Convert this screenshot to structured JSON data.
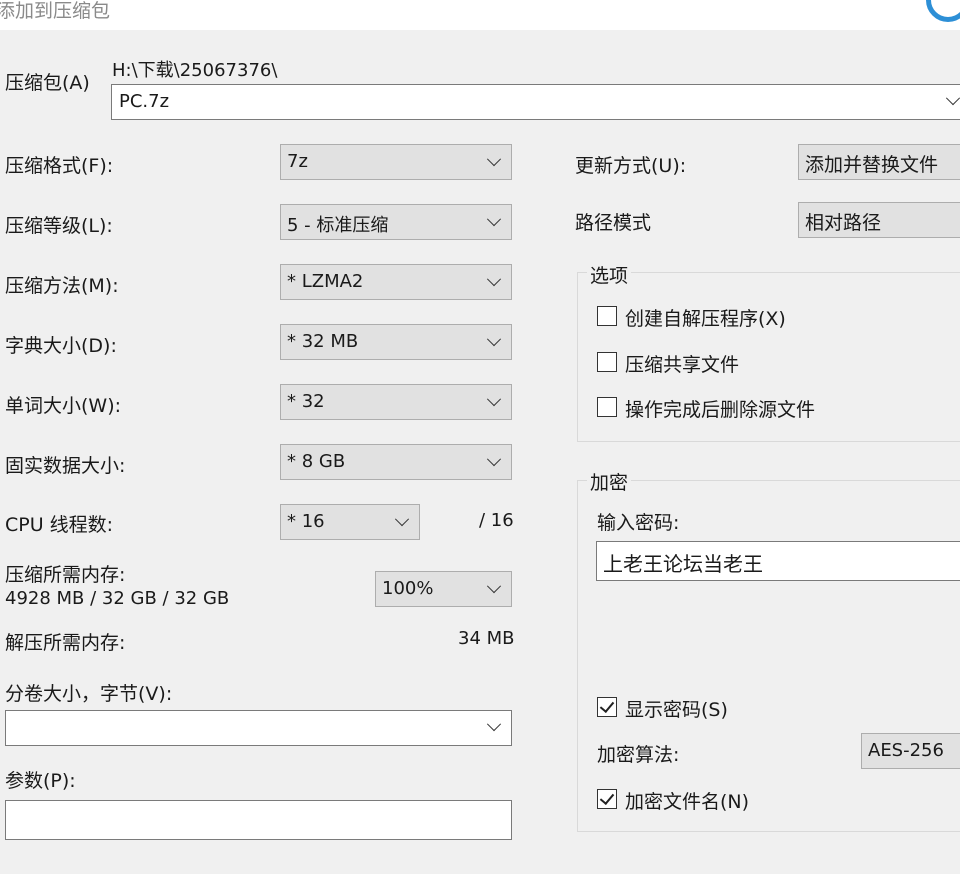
{
  "window": {
    "title": "添加到压缩包"
  },
  "archive": {
    "label": "压缩包(A)",
    "path": "H:\\下载\\25067376\\",
    "name": "PC.7z"
  },
  "left_fields": [
    {
      "label": "压缩格式(F):",
      "value": "7z"
    },
    {
      "label": "压缩等级(L):",
      "value": "5 - 标准压缩"
    },
    {
      "label": "压缩方法(M):",
      "value": "*  LZMA2"
    },
    {
      "label": "字典大小(D):",
      "value": "*  32 MB"
    },
    {
      "label": "单词大小(W):",
      "value": "*  32"
    },
    {
      "label": "固实数据大小:",
      "value": "*  8 GB"
    }
  ],
  "cpu": {
    "label": "CPU 线程数:",
    "value": "*  16",
    "max": "/ 16"
  },
  "memory": {
    "compress_label": "压缩所需内存:",
    "compress_value": "4928 MB / 32 GB / 32 GB",
    "percent": "100%",
    "decompress_label": "解压所需内存:",
    "decompress_value": "34 MB"
  },
  "split": {
    "label": "分卷大小，字节(V):",
    "value": ""
  },
  "params": {
    "label": "参数(P):",
    "value": ""
  },
  "update": {
    "label": "更新方式(U):",
    "value": "添加并替换文件"
  },
  "path_mode": {
    "label": "路径模式",
    "value": "相对路径"
  },
  "options": {
    "title": "选项",
    "items": [
      {
        "label": "创建自解压程序(X)",
        "checked": false
      },
      {
        "label": "压缩共享文件",
        "checked": false
      },
      {
        "label": "操作完成后删除源文件",
        "checked": false
      }
    ]
  },
  "encryption": {
    "title": "加密",
    "password_label": "输入密码:",
    "password": "上老王论坛当老王",
    "show_password": {
      "label": "显示密码(S)",
      "checked": true
    },
    "method_label": "加密算法:",
    "method": "AES-256",
    "encrypt_names": {
      "label": "加密文件名(N)",
      "checked": true
    }
  }
}
